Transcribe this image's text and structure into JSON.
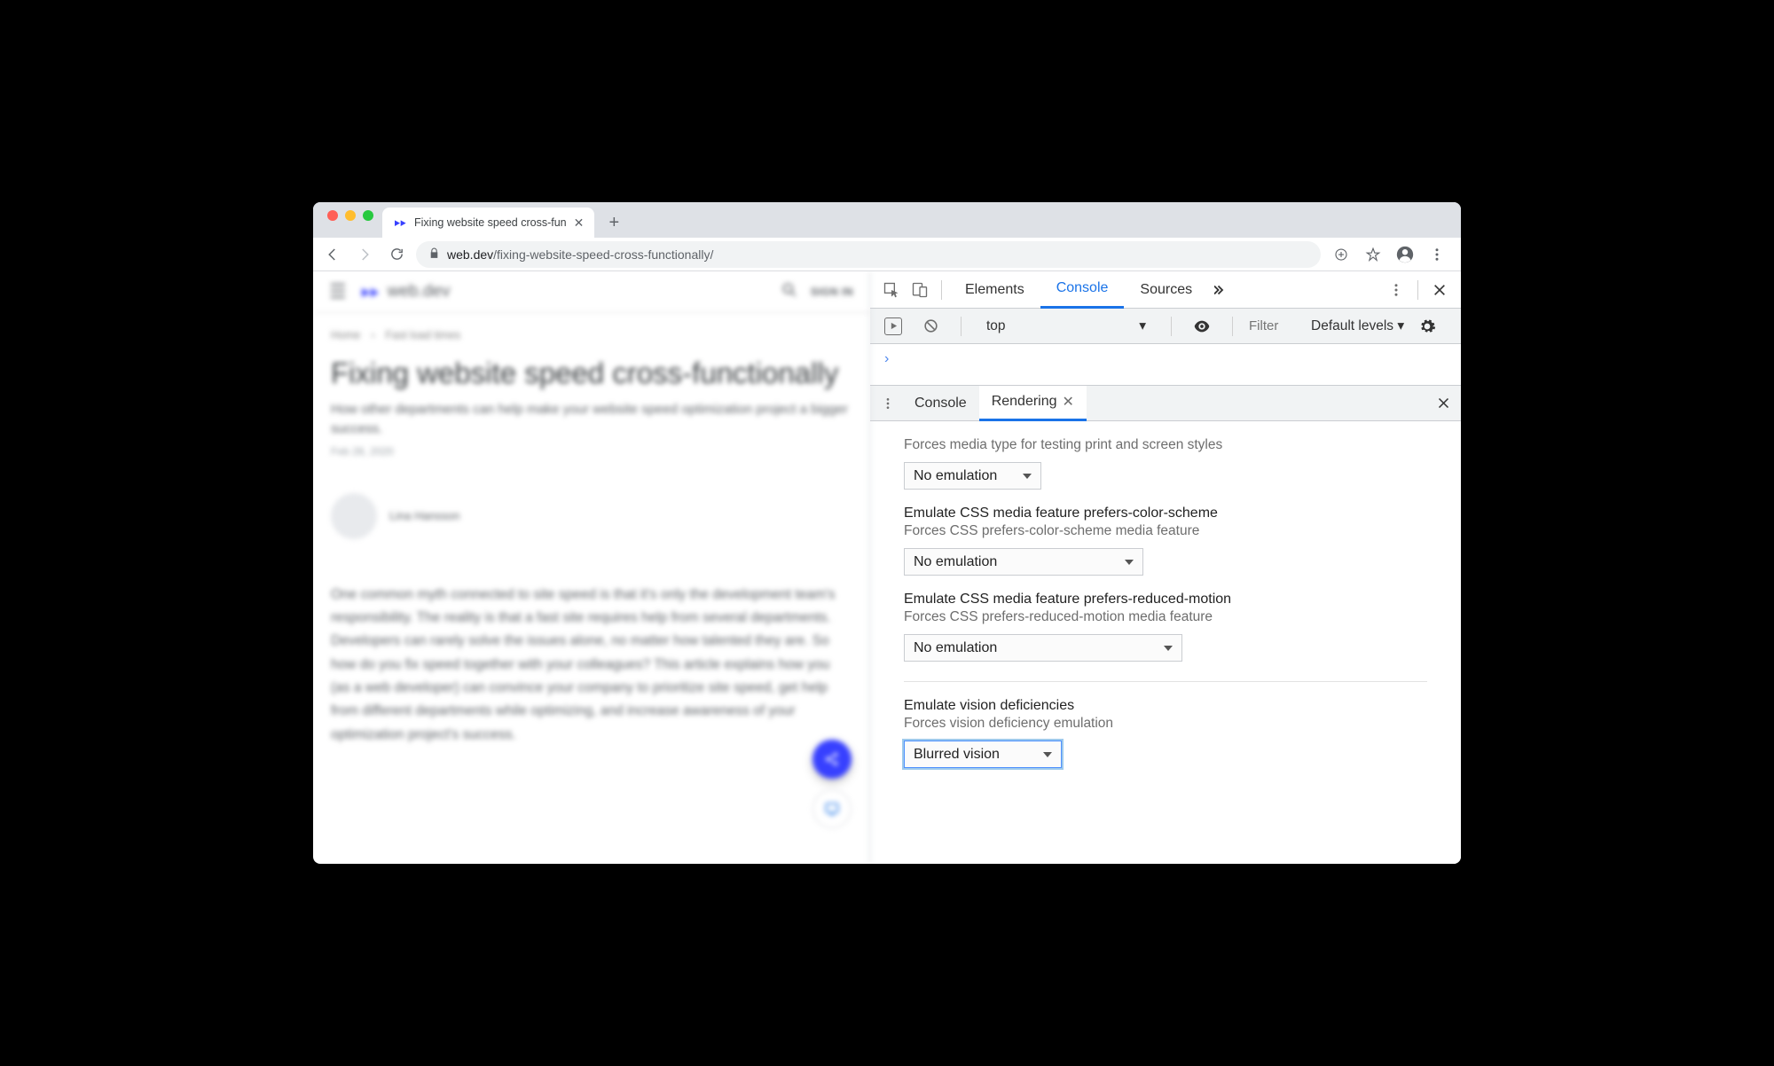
{
  "browser": {
    "tab_title": "Fixing website speed cross-fun",
    "url_host": "web.dev",
    "url_path": "/fixing-website-speed-cross-functionally/"
  },
  "page": {
    "site_name": "web.dev",
    "signin": "SIGN IN",
    "breadcrumb1": "Home",
    "breadcrumb_sep": "›",
    "breadcrumb2": "Fast load times",
    "h1": "Fixing website speed cross-functionally",
    "subtitle": "How other departments can help make your website speed optimization project a bigger success.",
    "date": "Feb 28, 2020",
    "author": "Lina Hansson",
    "paragraph": "One common myth connected to site speed is that it's only the development team's responsibility. The reality is that a fast site requires help from several departments. Developers can rarely solve the issues alone, no matter how talented they are. So how do you fix speed together with your colleagues? This article explains how you (as a web developer) can convince your company to prioritize site speed, get help from different departments while optimizing, and increase awareness of your optimization project's success."
  },
  "devtools": {
    "tabs": {
      "elements": "Elements",
      "console": "Console",
      "sources": "Sources"
    },
    "console_bar": {
      "context": "top",
      "filter_placeholder": "Filter",
      "levels": "Default levels ▾"
    },
    "drawer": {
      "console": "Console",
      "rendering": "Rendering",
      "media_type_desc": "Forces media type for testing print and screen styles",
      "media_type_value": "No emulation",
      "pcs_title": "Emulate CSS media feature prefers-color-scheme",
      "pcs_desc": "Forces CSS prefers-color-scheme media feature",
      "pcs_value": "No emulation",
      "prm_title": "Emulate CSS media feature prefers-reduced-motion",
      "prm_desc": "Forces CSS prefers-reduced-motion media feature",
      "prm_value": "No emulation",
      "vision_title": "Emulate vision deficiencies",
      "vision_desc": "Forces vision deficiency emulation",
      "vision_value": "Blurred vision"
    }
  }
}
